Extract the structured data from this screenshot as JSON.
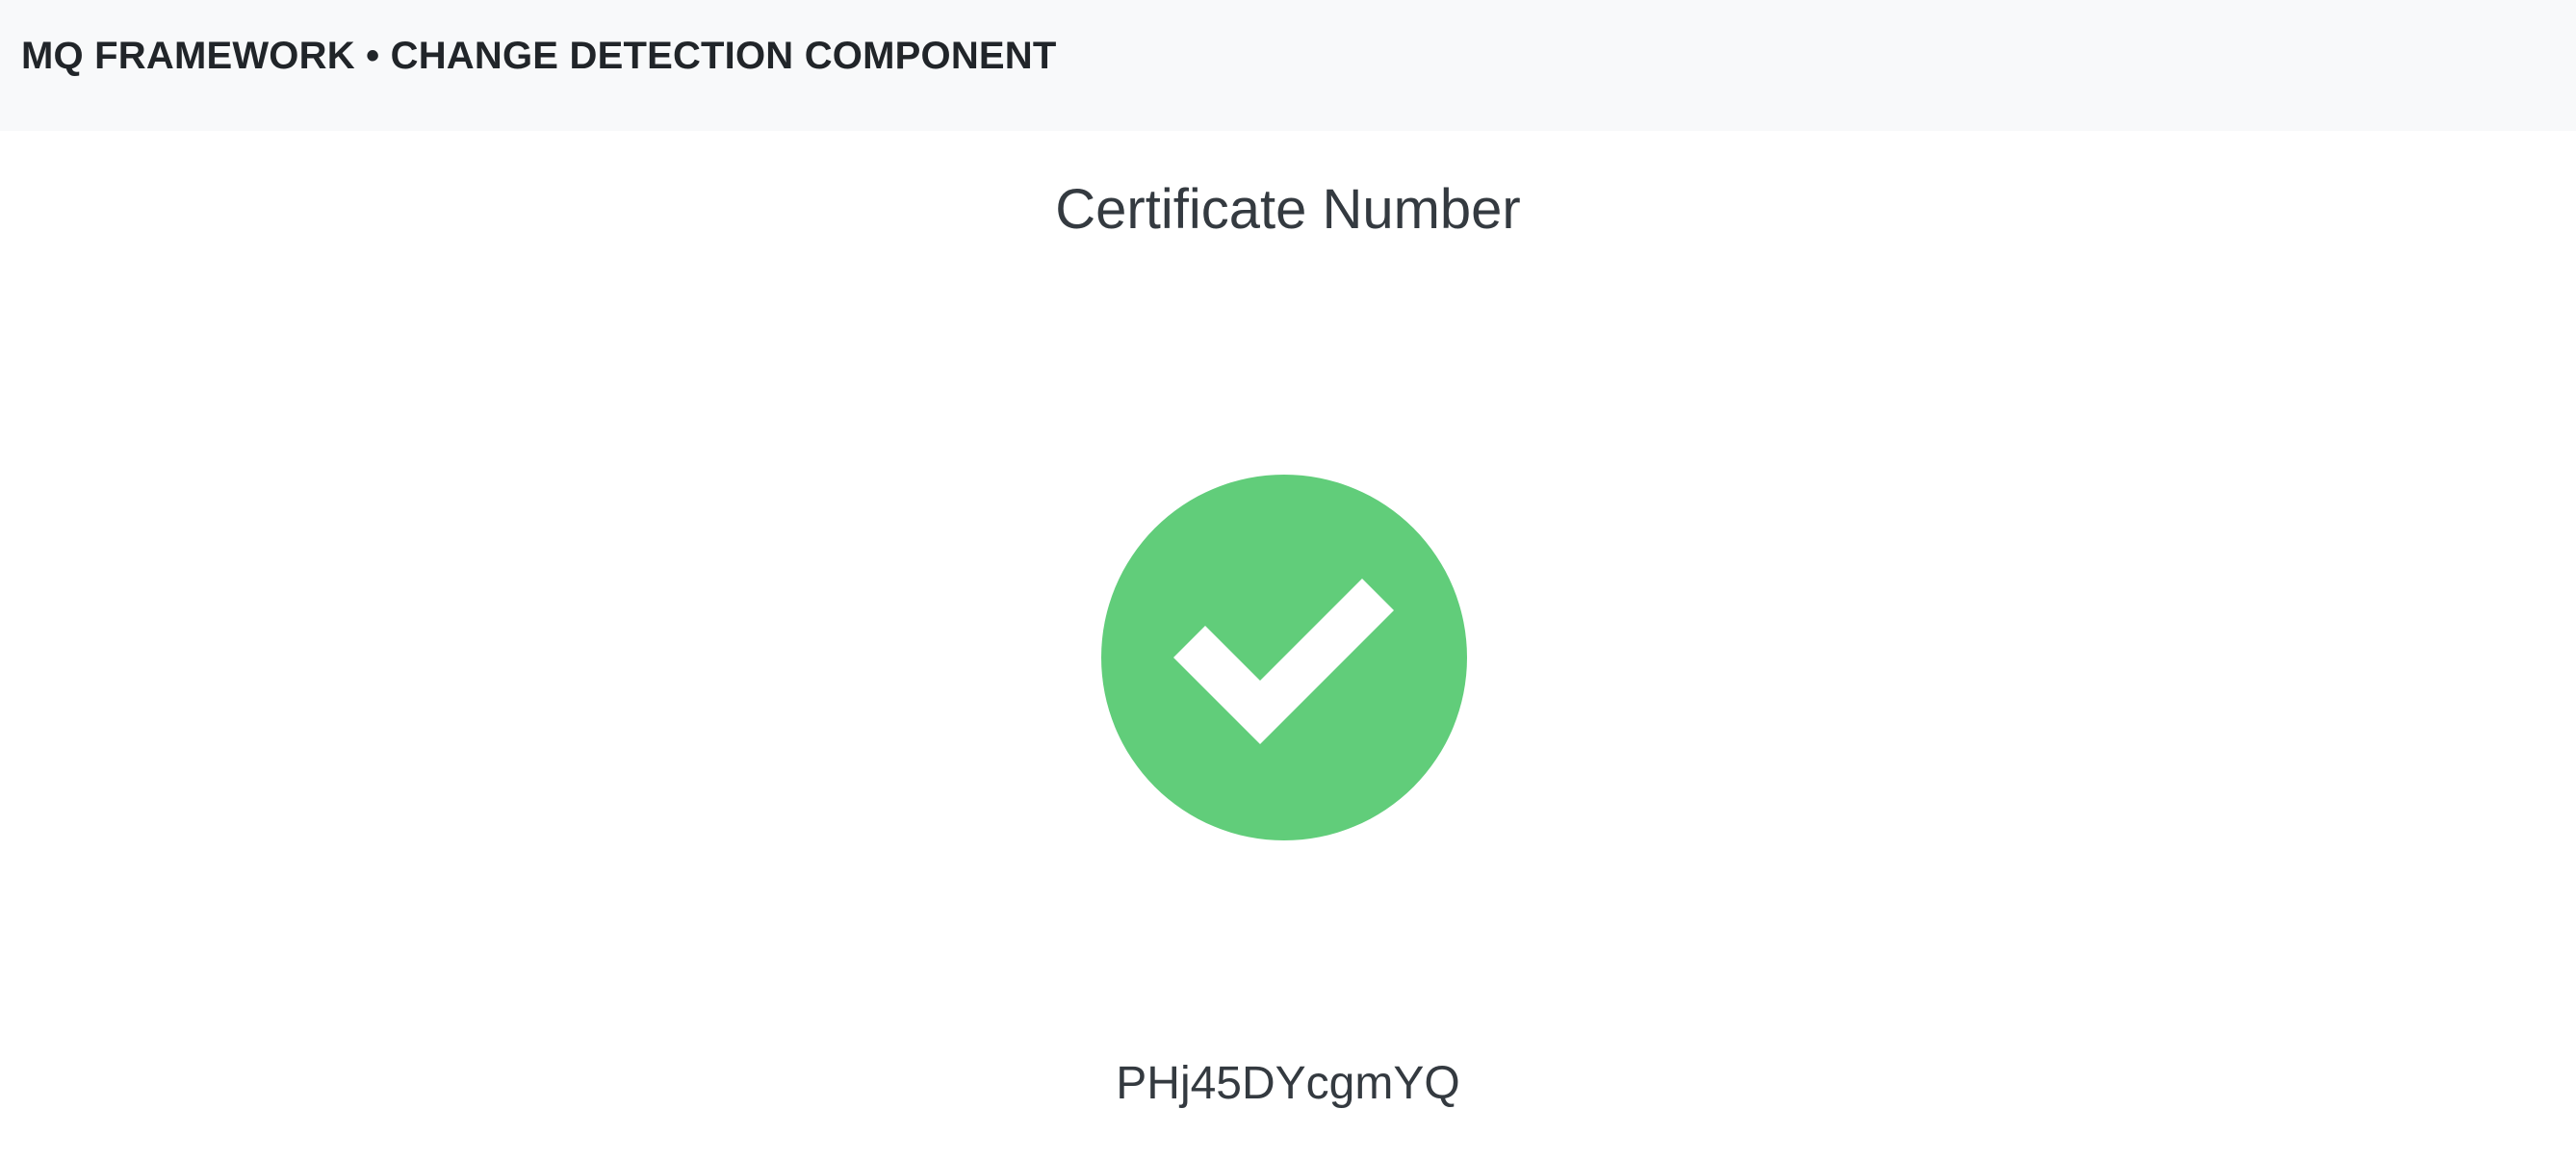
{
  "header": {
    "title": "MQ FRAMEWORK • CHANGE DETECTION COMPONENT"
  },
  "main": {
    "title": "Certificate Number",
    "status_icon": "check-circle-icon",
    "status_color": "#61cd7a",
    "certificate_number": "PHj45DYcgmYQ"
  }
}
